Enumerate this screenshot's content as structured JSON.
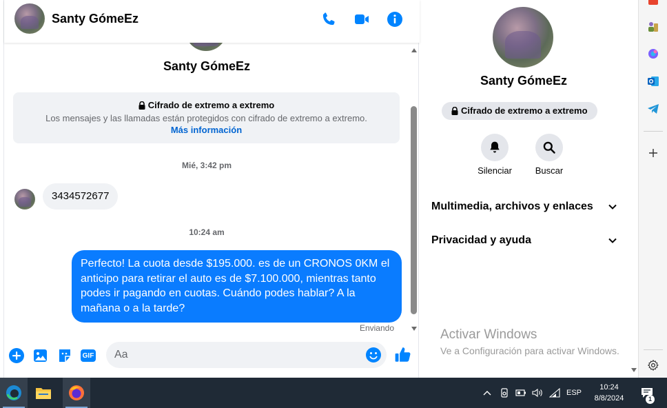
{
  "chat": {
    "header": {
      "name": "Santy GómeEz"
    },
    "intro": {
      "name": "Santy GómeEz",
      "e2e_title": "Cifrado de extremo a extremo",
      "e2e_text": "Los mensajes y las llamadas están protegidos con cifrado de extremo a extremo.",
      "e2e_link": "Más información"
    },
    "messages": [
      {
        "timestamp": "Mié, 3:42 pm",
        "direction": "incoming",
        "text": "3434572677"
      },
      {
        "timestamp": "10:24 am",
        "direction": "outgoing",
        "text": "Perfecto! La cuota desde $195.000. es de un CRONOS 0KM el anticipo para retirar el auto es de $7.100.000, mientras tanto podes ir pagando en cuotas. Cuándo podes hablar? A la mañana o a la tarde?"
      }
    ],
    "status": "Enviando",
    "composer": {
      "placeholder": "Aa",
      "gif_label": "GIF"
    }
  },
  "info_panel": {
    "name": "Santy GómeEz",
    "e2e_pill": "Cifrado de extremo a extremo",
    "actions": [
      {
        "label": "Silenciar"
      },
      {
        "label": "Buscar"
      }
    ],
    "sections": [
      {
        "label": "Multimedia, archivos y enlaces"
      },
      {
        "label": "Privacidad y ayuda"
      }
    ],
    "watermark": {
      "title": "Activar Windows",
      "subtitle": "Ve a Configuración para activar Windows."
    }
  },
  "taskbar": {
    "language": "ESP",
    "time": "10:24",
    "date": "8/8/2024",
    "notification_count": "1"
  },
  "colors": {
    "accent": "#0a7cff",
    "icon_blue": "#0084ff",
    "taskbar": "#1f2a36"
  }
}
